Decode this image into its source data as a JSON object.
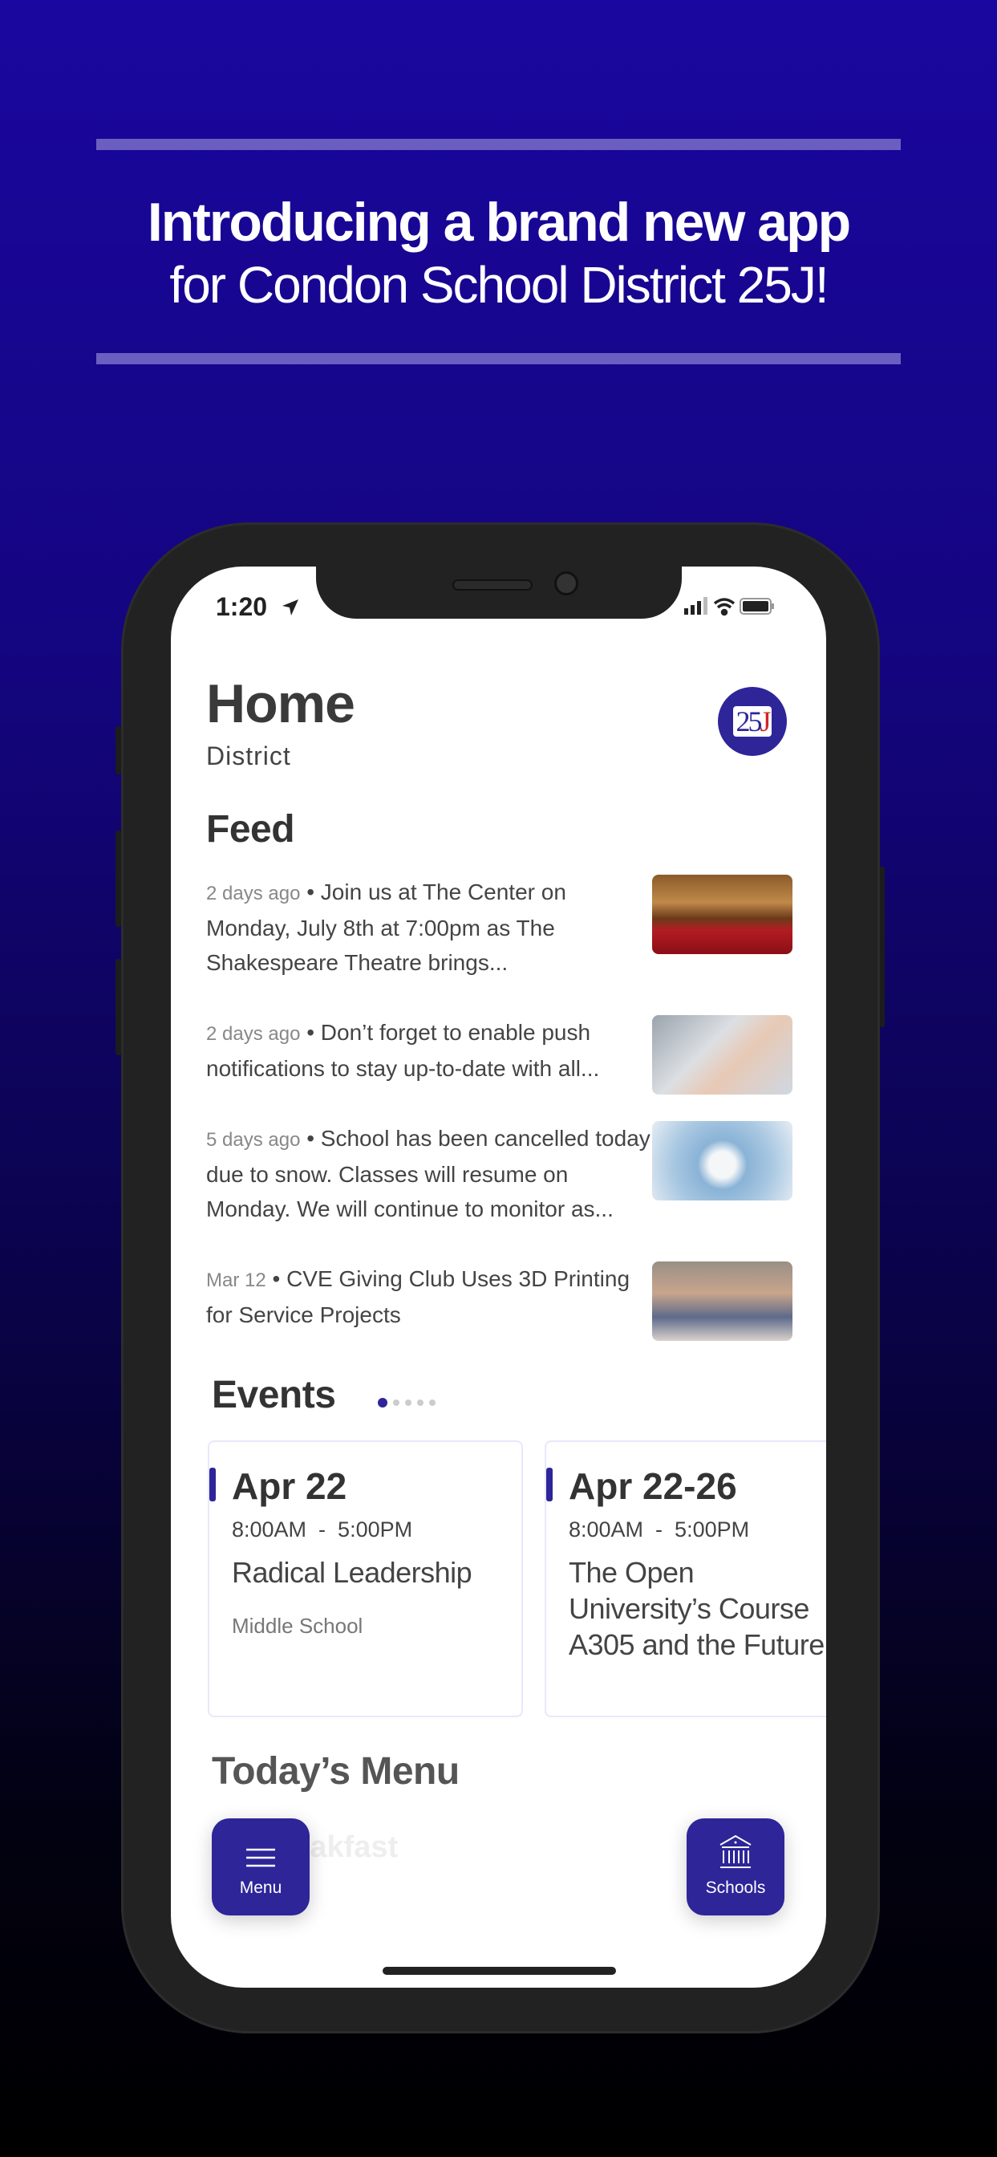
{
  "promo": {
    "headline": "Introducing a brand new app",
    "subheadline": "for Condon School District 25J!"
  },
  "status_bar": {
    "time": "1:20",
    "icons": [
      "location-arrow-icon",
      "signal-icon",
      "wifi-icon",
      "battery-icon"
    ]
  },
  "header": {
    "title": "Home",
    "subtitle": "District",
    "logo_text": "25J"
  },
  "feed": {
    "title": "Feed",
    "items": [
      {
        "ago": "2 days ago",
        "text": "Join us at The Center on Monday, July 8th at 7:00pm as The Shakespeare Theatre brings...",
        "image": "theater-seats"
      },
      {
        "ago": "2 days ago",
        "text": "Don’t forget to enable push notifications to stay up-to-date with all...",
        "image": "hand-with-phone"
      },
      {
        "ago": "5 days ago",
        "text": "School has been cancelled today due to snow. Classes will resume on Monday. We will continue to monitor as...",
        "image": "snowflake-mittens"
      },
      {
        "ago": "Mar 12",
        "text": "CVE Giving Club Uses 3D Printing for Service Projects",
        "image": "classroom-kids"
      }
    ]
  },
  "events": {
    "title": "Events",
    "page_count": 5,
    "active_page": 1,
    "items": [
      {
        "date": "Apr 22",
        "time": "8:00AM  -  5:00PM",
        "name": "Radical Leadership",
        "location": "Middle School"
      },
      {
        "date": "Apr 22-26",
        "time": "8:00AM  -  5:00PM",
        "name": "The Open University’s Course A305 and the Future",
        "location": ""
      }
    ]
  },
  "menu_section": {
    "title": "Today’s Menu",
    "partial": "Breakfast"
  },
  "nav": {
    "menu_label": "Menu",
    "schools_label": "Schools"
  },
  "colors": {
    "accent": "#2e2599",
    "background_top": "#1a079f",
    "background_bottom": "#000000"
  }
}
